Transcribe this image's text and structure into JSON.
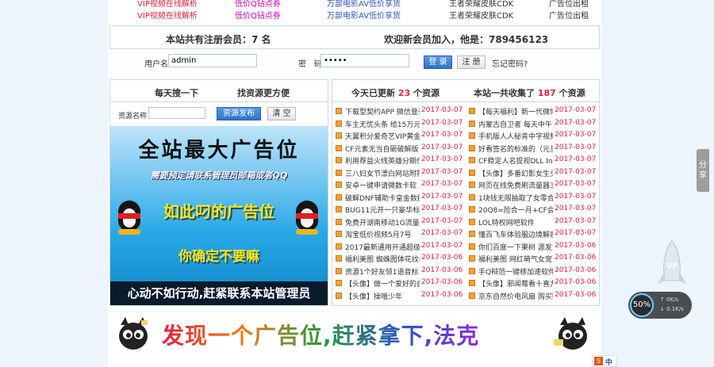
{
  "top_links": {
    "row1": [
      {
        "text": "VIP视频在线解析",
        "color": "red"
      },
      {
        "text": "低价Q钻点券",
        "color": "magenta"
      },
      {
        "text": "万部电影AV低价享货",
        "color": "blue"
      },
      {
        "text": "王者荣耀皮肤CDK",
        "color": "dark"
      },
      {
        "text": "广告位出租",
        "color": "dark"
      }
    ],
    "row2": [
      {
        "text": "VIP视频在线解析",
        "color": "red"
      },
      {
        "text": "低价Q钻点券",
        "color": "magenta"
      },
      {
        "text": "万部电影AV低价享货",
        "color": "blue"
      },
      {
        "text": "王者荣耀皮肤CDK",
        "color": "dark"
      },
      {
        "text": "广告位出租",
        "color": "dark"
      }
    ]
  },
  "members": {
    "count_text": "本站共有注册会员：7 名",
    "welcome_text": "欢迎新会员加入，他是：789456123"
  },
  "login": {
    "username_label": "用户名",
    "username_value": "admin",
    "password_label": "密　码",
    "password_value": "•••••",
    "login_button": "登 录",
    "register_button": "注 册",
    "forgot_link": "忘记密码?"
  },
  "left_panel": {
    "header_left": "每天搜一下",
    "header_right": "找资源更方便",
    "search_label": "资源名称",
    "search_value": "",
    "publish_button": "资源发布",
    "clear_button": "清 空"
  },
  "ad_banner": {
    "line1": "全站最大广告位",
    "line2": "需要预定请联系管理员邮箱或者QQ",
    "line3": "如此叼的广告位",
    "line4": "你确定不要嘛",
    "line5": "心动不如行动,赶紧联系本站管理员"
  },
  "right_panel": {
    "today_prefix": "今天已更新",
    "today_count": "23",
    "today_suffix": "个资源",
    "total_prefix": "本站一共收集了",
    "total_count": "187",
    "total_suffix": "个资源"
  },
  "resources_left": [
    {
      "title": "下载型契约APP 微信登录",
      "date": "2017-03-07"
    },
    {
      "title": "车主无忧头条 给15万元赞",
      "date": "2017-03-07"
    },
    {
      "title": "天翼积分爱奇艺VIP黄金会",
      "date": "2017-03-07"
    },
    {
      "title": "CF元素无当自砸破解版 今",
      "date": "2017-03-07"
    },
    {
      "title": "利用荐益火线英雄分期付",
      "date": "2017-03-07"
    },
    {
      "title": "三八妇女节漂白网站附符",
      "date": "2017-03-07"
    },
    {
      "title": "安卓一键申请微数卡软",
      "date": "2017-03-07"
    },
    {
      "title": "破解DNF辅助卡皇金数提",
      "date": "2017-03-07"
    },
    {
      "title": "BUG11元开一只豪华标站",
      "date": "2017-03-07"
    },
    {
      "title": "免费开湖南移动1G流量 抢",
      "date": "2017-03-07"
    },
    {
      "title": "淘宝低价视频5月7号",
      "date": "2017-03-07"
    },
    {
      "title": "2017最新通用开通超级会",
      "date": "2017-03-07"
    },
    {
      "title": "福利美图 蜘蛛图体花纹器",
      "date": "2017-03-06"
    },
    {
      "title": "资源1个好友领1语音标",
      "date": "2017-03-06"
    },
    {
      "title": "【头像】做一个爱好的自",
      "date": "2017-03-06"
    },
    {
      "title": "【头像】操哦少年",
      "date": "2017-03-06"
    }
  ],
  "resources_right": [
    {
      "title": "【每天福利】新一代微博",
      "date": "2017-03-07"
    },
    {
      "title": "内蒙古自卫者 每天中午12",
      "date": "2017-03-07"
    },
    {
      "title": "手机版人人秘肯中字视频",
      "date": "2017-03-07"
    },
    {
      "title": "好看签名的标准的（元旦",
      "date": "2017-03-07"
    },
    {
      "title": "CF稳定人名提视DLL Inser",
      "date": "2017-03-07"
    },
    {
      "title": "【头像】多番幻影女生头",
      "date": "2017-03-07"
    },
    {
      "title": "网页在线免费刷流量器30",
      "date": "2017-03-07"
    },
    {
      "title": "1块钱无限抽取了女零合并",
      "date": "2017-03-07"
    },
    {
      "title": "20Q8=险合一月+CF会员",
      "date": "2017-03-07"
    },
    {
      "title": "LOL特权网吧软件",
      "date": "2017-03-07"
    },
    {
      "title": "懂百飞车体验服边境解惑",
      "date": "2017-03-07"
    },
    {
      "title": "你们百度一下果树 源发货",
      "date": "2017-03-06"
    },
    {
      "title": "福利美图 网红萌气女宠",
      "date": "2017-03-06"
    },
    {
      "title": "手Q辩范一键移加速软件",
      "date": "2017-03-06"
    },
    {
      "title": "【头像】邪闻莓看十喜九",
      "date": "2017-03-06"
    },
    {
      "title": "京东自然价电风扇 购买购",
      "date": "2017-03-06"
    }
  ],
  "bottom_ad": {
    "text": "发现一个广告位,赶紧拿下,法克"
  },
  "side_widgets": {
    "share_label": "分享",
    "up_label": "UP",
    "speed_percent": "50%",
    "speed_up": "0K/s",
    "speed_down": "0.1K/s",
    "ime_label": "中"
  },
  "colors": {
    "accent_red": "#e5213b",
    "button_blue": "#2f72c9",
    "panel_border": "#c8d9ec",
    "ad_blue": "#27a8e6"
  }
}
